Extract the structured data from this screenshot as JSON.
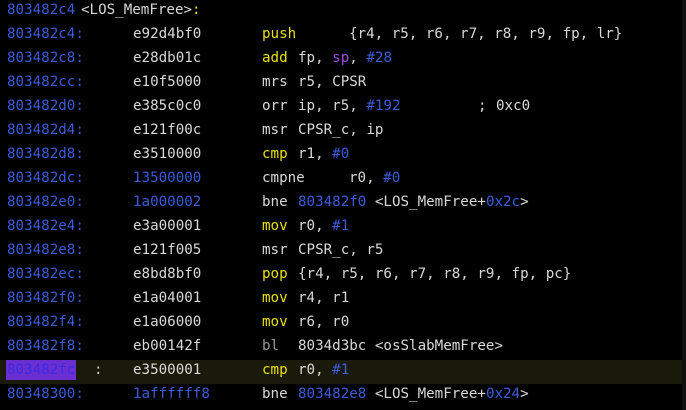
{
  "header": {
    "address": "803482c4",
    "label": "<LOS_MemFree>",
    "colon": ":"
  },
  "colors": {
    "address": "#3b5bd9",
    "mnemonic": "#e8e000",
    "text": "#d8d8d8",
    "immediate": "#3b5bd9",
    "comment": "#9f48e0",
    "highlight": "#6a2ed1"
  },
  "rows": [
    {
      "addr": "803482c4:",
      "bytes": "e92d4bf0",
      "mn": "push",
      "ops": "{r4, r5, r6, r7, r8, r9, fp, lr}"
    },
    {
      "addr": "803482c8:",
      "bytes": "e28db01c",
      "mn": "add",
      "ops_a": "fp,",
      "ops_b": "sp",
      "ops_c": ", ",
      "ops_d": "#28"
    },
    {
      "addr": "803482cc:",
      "bytes": "e10f5000",
      "mn": "mrs",
      "ops": "r5, CPSR"
    },
    {
      "addr": "803482d0:",
      "bytes": "e385c0c0",
      "mn": "orr",
      "ops_a": "ip, r5, ",
      "ops_b": "#192",
      "comment": ";",
      "comment_val": "0xc0"
    },
    {
      "addr": "803482d4:",
      "bytes": "e121f00c",
      "mn": "msr",
      "ops": "CPSR_c, ip"
    },
    {
      "addr": "803482d8:",
      "bytes": "e3510000",
      "mn": "cmp",
      "ops_a": "r1, ",
      "ops_b": "#0"
    },
    {
      "addr": "803482dc:",
      "bytes": "13500000",
      "mn": "cmpne",
      "ops_a": "r0, ",
      "ops_b": "#0"
    },
    {
      "addr": "803482e0:",
      "bytes": "1a000002",
      "mn": "bne",
      "target": "803482f0",
      "sym_a": "<LOS_MemFree+",
      "sym_b": "0x2c",
      "sym_c": ">"
    },
    {
      "addr": "803482e4:",
      "bytes": "e3a00001",
      "mn": "mov",
      "ops_a": "r0, ",
      "ops_b": "#1"
    },
    {
      "addr": "803482e8:",
      "bytes": "e121f005",
      "mn": "msr",
      "ops": "CPSR_c, r5"
    },
    {
      "addr": "803482ec:",
      "bytes": "e8bd8bf0",
      "mn": "pop",
      "ops": "{r4, r5, r6, r7, r8, r9, fp, pc}"
    },
    {
      "addr": "803482f0:",
      "bytes": "e1a04001",
      "mn": "mov",
      "ops": "r4, r1"
    },
    {
      "addr": "803482f4:",
      "bytes": "e1a06000",
      "mn": "mov",
      "ops": "r6, r0"
    },
    {
      "addr": "803482f8:",
      "bytes": "eb00142f",
      "mn": "bl",
      "target": "8034d3bc",
      "sym_full": "<osSlabMemFree>"
    },
    {
      "addr": "803482fc",
      "addr_colon": ":",
      "bytes": "e3500001",
      "mn": "cmp",
      "ops_a": "r0, ",
      "ops_b": "#1"
    },
    {
      "addr": "80348300:",
      "bytes": "1affffff8",
      "mn": "bne",
      "target": "803482e8",
      "sym_a": "<LOS_MemFree+",
      "sym_b": "0x24",
      "sym_c": ">"
    }
  ]
}
